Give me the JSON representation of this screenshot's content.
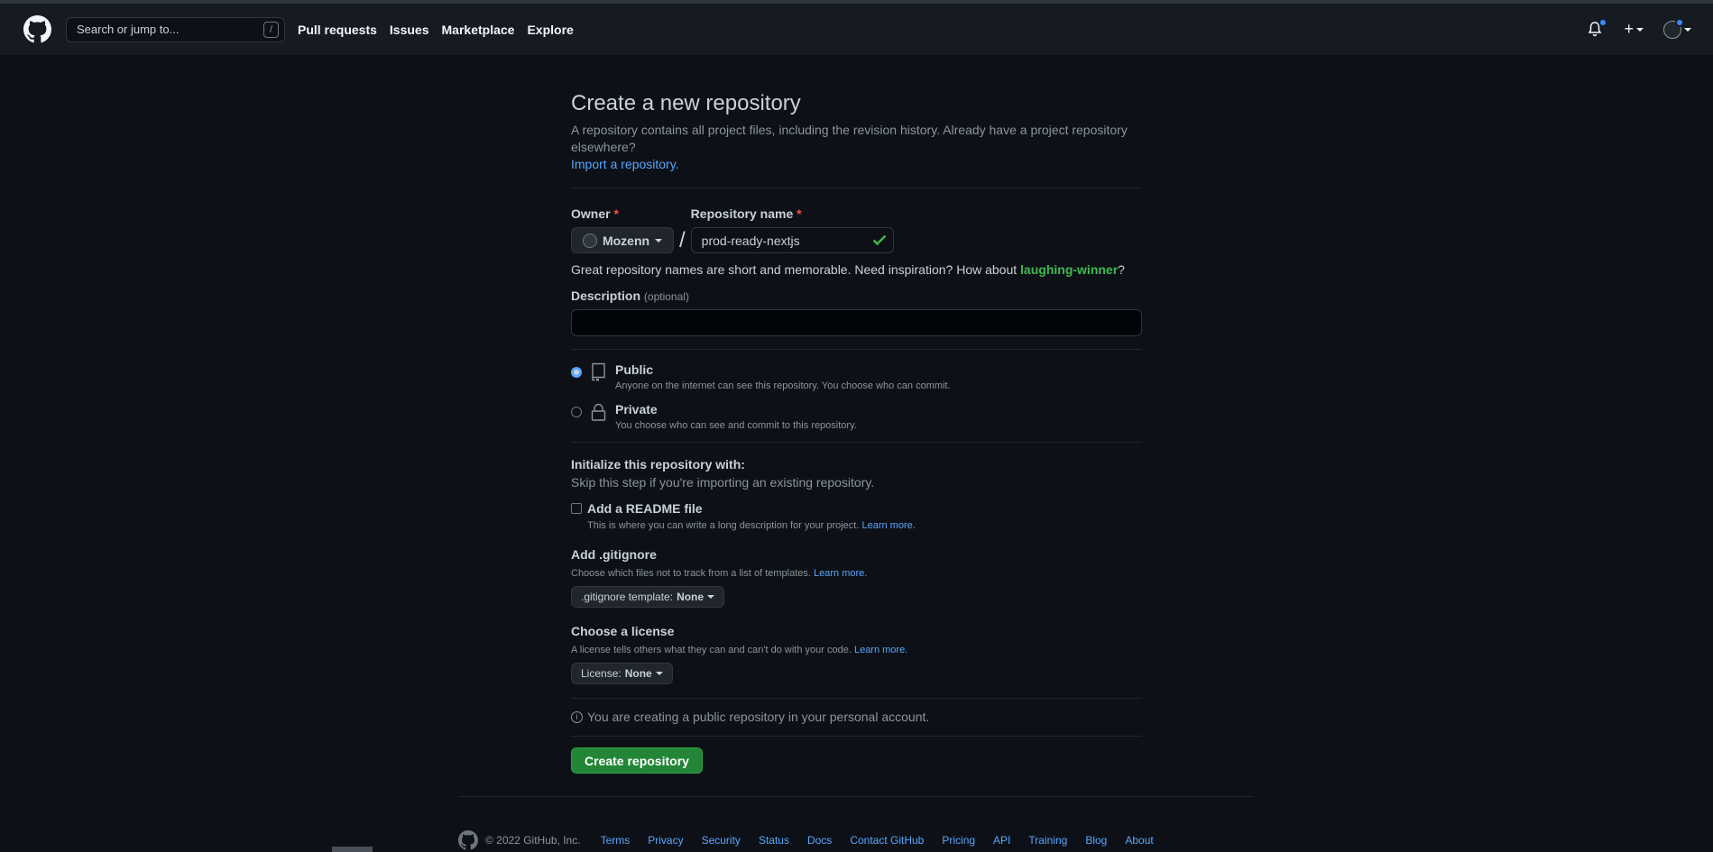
{
  "header": {
    "search_placeholder": "Search or jump to...",
    "search_shortcut": "/",
    "nav": [
      "Pull requests",
      "Issues",
      "Marketplace",
      "Explore"
    ]
  },
  "page": {
    "title": "Create a new repository",
    "subtitle": "A repository contains all project files, including the revision history. Already have a project repository elsewhere?",
    "import_link": "Import a repository.",
    "owner_label": "Owner",
    "required_mark": "*",
    "owner_value": "Mozenn",
    "separator": "/",
    "repo_label": "Repository name",
    "repo_value": "prod-ready-nextjs",
    "hint_prefix": "Great repository names are short and memorable. Need inspiration? How about",
    "hint_suggestion": "laughing-winner",
    "hint_suffix": "?",
    "description_label": "Description",
    "description_optional": "(optional)",
    "description_value": ""
  },
  "visibility": {
    "public_title": "Public",
    "public_desc": "Anyone on the internet can see this repository. You choose who can commit.",
    "private_title": "Private",
    "private_desc": "You choose who can see and commit to this repository.",
    "selected": "public"
  },
  "init": {
    "title": "Initialize this repository with:",
    "subtitle": "Skip this step if you're importing an existing repository.",
    "readme_label": "Add a README file",
    "readme_desc": "This is where you can write a long description for your project.",
    "learn_more": "Learn more.",
    "gitignore_title": "Add .gitignore",
    "gitignore_desc": "Choose which files not to track from a list of templates.",
    "gitignore_button_prefix": ".gitignore template:",
    "gitignore_button_value": "None",
    "license_title": "Choose a license",
    "license_desc": "A license tells others what they can and can't do with your code.",
    "license_button_prefix": "License:",
    "license_button_value": "None"
  },
  "info_text": "You are creating a public repository in your personal account.",
  "create_button": "Create repository",
  "footer": {
    "copyright": "© 2022 GitHub, Inc.",
    "links": [
      "Terms",
      "Privacy",
      "Security",
      "Status",
      "Docs",
      "Contact GitHub",
      "Pricing",
      "API",
      "Training",
      "Blog",
      "About"
    ]
  },
  "colors": {
    "background": "#0d1117",
    "header": "#161b22",
    "link": "#58a6ff",
    "success": "#3fb950",
    "primary_button": "#238636"
  },
  "icons": [
    "github-logo-icon",
    "bell-icon",
    "plus-icon",
    "check-icon",
    "repo-icon",
    "lock-icon",
    "info-icon"
  ]
}
